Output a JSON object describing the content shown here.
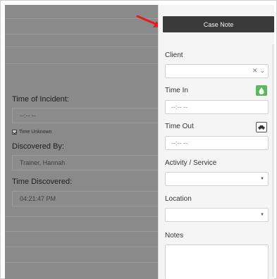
{
  "panel": {
    "title": "Case Note",
    "fields": {
      "client_label": "Client",
      "time_in_label": "Time In",
      "time_in_value": "--:-- --",
      "time_out_label": "Time Out",
      "time_out_value": "--:-- --",
      "activity_label": "Activity / Service",
      "location_label": "Location",
      "notes_label": "Notes"
    }
  },
  "background_form": {
    "time_of_incident_label": "Time of Incident:",
    "time_of_incident_value": "--:-- --",
    "time_unknown_label": "Time Unknown",
    "discovered_by_label": "Discovered By:",
    "discovered_by_value": "Trainer, Hannah",
    "time_discovered_label": "Time Discovered:",
    "time_discovered_value": "04:21:47 PM"
  },
  "colors": {
    "header_bg": "#3a3a3a",
    "accent_green": "#5cb85c",
    "arrow_red": "#e11d1d",
    "overlay_gray": "#8a8a8a"
  }
}
